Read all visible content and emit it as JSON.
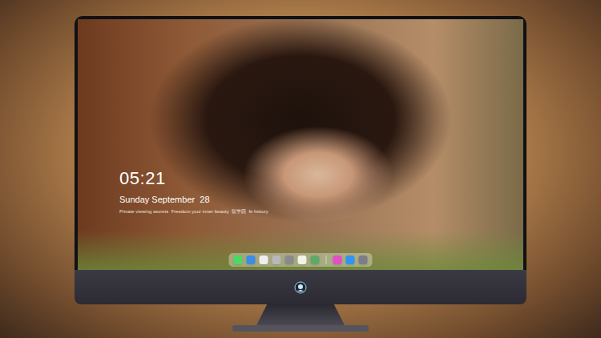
{
  "screen": {
    "time": "05:21",
    "date": "Sunday September  28",
    "caption": "Private viewing secrets  Freedom your inner beauty  留学园  fe history"
  },
  "dock": [
    {
      "kind": "app",
      "color": "#4cd964"
    },
    {
      "kind": "app",
      "color": "#3b8ee8"
    },
    {
      "kind": "app",
      "color": "#eeeeee"
    },
    {
      "kind": "app",
      "color": "#b8b8b8"
    },
    {
      "kind": "app",
      "color": "#8a8a8a"
    },
    {
      "kind": "app",
      "color": "#f4f1e6"
    },
    {
      "kind": "app",
      "color": "#5fa86a"
    },
    {
      "kind": "divider"
    },
    {
      "kind": "app",
      "color": "#e24fc7"
    },
    {
      "kind": "app",
      "color": "#2f95f0"
    },
    {
      "kind": "app",
      "color": "#7d7d85"
    }
  ]
}
